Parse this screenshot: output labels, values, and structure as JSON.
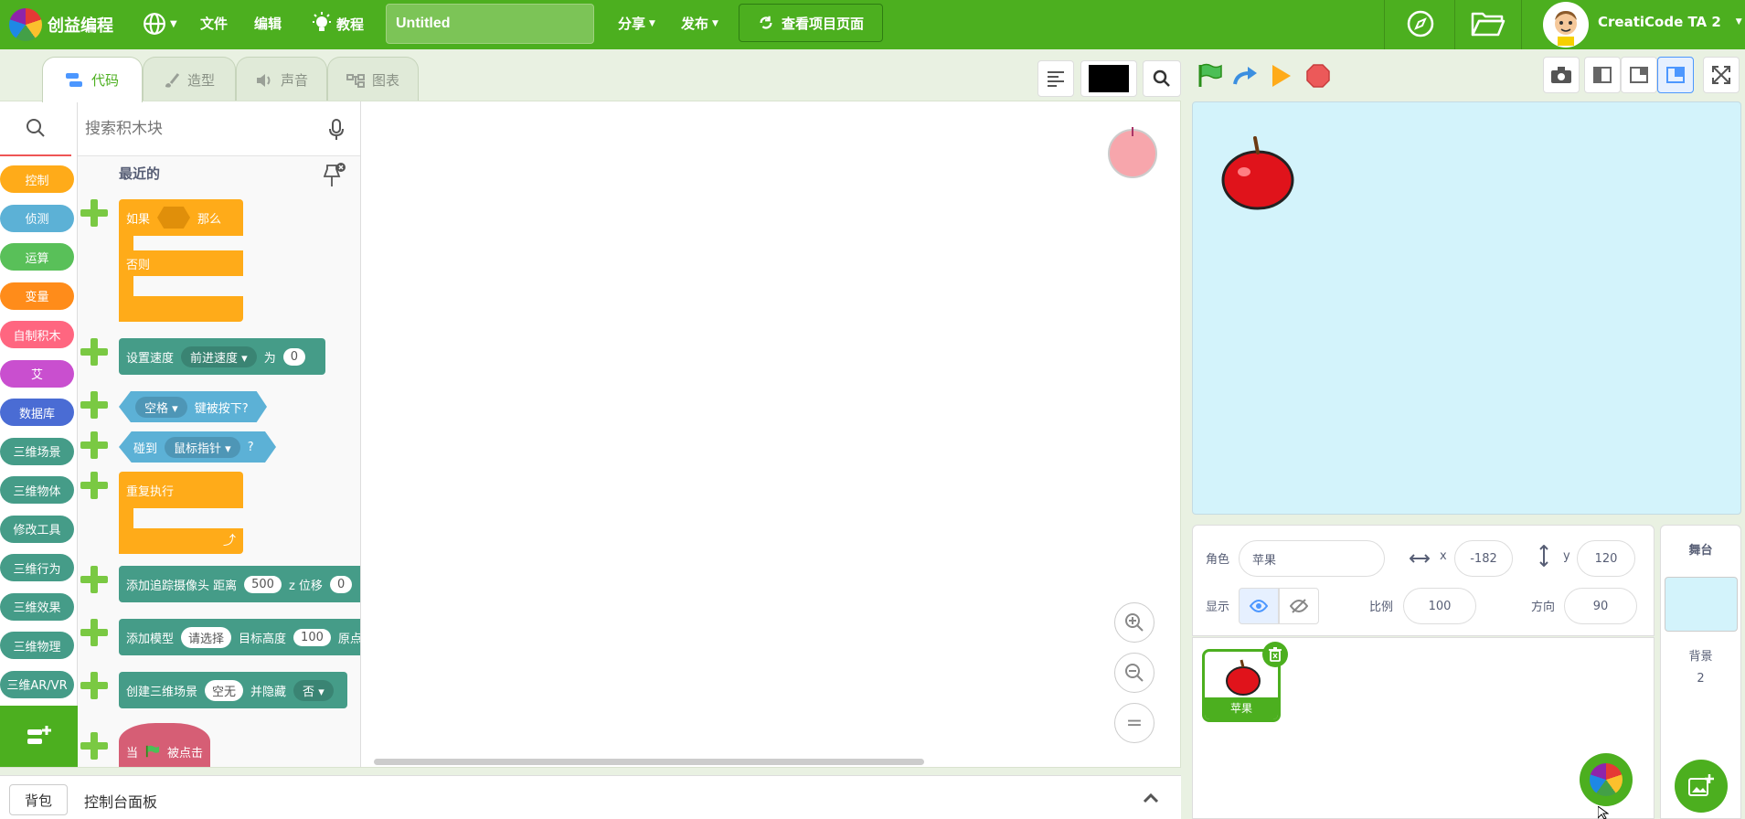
{
  "topbar": {
    "brand": "创益编程",
    "menu_file": "文件",
    "menu_edit": "编辑",
    "menu_tutorial": "教程",
    "project_title": "Untitled",
    "menu_share": "分享",
    "menu_publish": "发布",
    "view_project_page": "查看项目页面",
    "username": "CreatiCode TA 2"
  },
  "tabs": {
    "code": "代码",
    "costume": "造型",
    "sound": "声音",
    "chart": "图表"
  },
  "categories": [
    {
      "label": "控制",
      "color": "#ffab19"
    },
    {
      "label": "侦测",
      "color": "#5cb1d6"
    },
    {
      "label": "运算",
      "color": "#59c059"
    },
    {
      "label": "变量",
      "color": "#ff8c1a"
    },
    {
      "label": "自制积木",
      "color": "#ff6680"
    },
    {
      "label": "艾",
      "color": "#c94fcf"
    },
    {
      "label": "数据库",
      "color": "#4a6cd4"
    },
    {
      "label": "三维场景",
      "color": "#459c88"
    },
    {
      "label": "三维物体",
      "color": "#459c88"
    },
    {
      "label": "修改工具",
      "color": "#459c88"
    },
    {
      "label": "三维行为",
      "color": "#459c88"
    },
    {
      "label": "三维效果",
      "color": "#459c88"
    },
    {
      "label": "三维物理",
      "color": "#459c88"
    },
    {
      "label": "三维AR/VR",
      "color": "#459c88"
    }
  ],
  "palette": {
    "search_placeholder": "搜索积木块",
    "section_recent": "最近的",
    "blocks": {
      "if_label": "如果",
      "then_label": "那么",
      "else_label": "否则",
      "set_speed": "设置速度",
      "speed_option": "前进速度",
      "to_label": "为",
      "speed_value": "0",
      "key_option": "空格",
      "key_pressed": "键被按下?",
      "touching": "碰到",
      "touching_option": "鼠标指针",
      "question_mark": "?",
      "forever": "重复执行",
      "add_camera": "添加追踪摄像头 距离",
      "camera_distance": "500",
      "z_offset": "z 位移",
      "z_value": "0",
      "add_model": "添加模型",
      "model_option": "请选择",
      "target_height": "目标高度",
      "height_value": "100",
      "origin": "原点",
      "create_scene": "创建三维场景",
      "scene_option": "空无",
      "and_hide": "并隐藏",
      "hide_option": "否",
      "when_label": "当",
      "clicked_label": "被点击"
    }
  },
  "sprite_info": {
    "sprite_label": "角色",
    "sprite_name": "苹果",
    "x_label": "x",
    "x_value": "-182",
    "y_label": "y",
    "y_value": "120",
    "show_label": "显示",
    "size_label": "比例",
    "size_value": "100",
    "direction_label": "方向",
    "direction_value": "90"
  },
  "sprite_list": [
    {
      "name": "苹果"
    }
  ],
  "stage_panel": {
    "title": "舞台",
    "backdrops_label": "背景",
    "backdrops_count": "2"
  },
  "bottom": {
    "backpack": "背包",
    "console": "控制台面板"
  },
  "colors": {
    "brand_green": "#4caf1f",
    "stage_bg": "#d3f3fb",
    "apple_red": "#e0131b"
  }
}
